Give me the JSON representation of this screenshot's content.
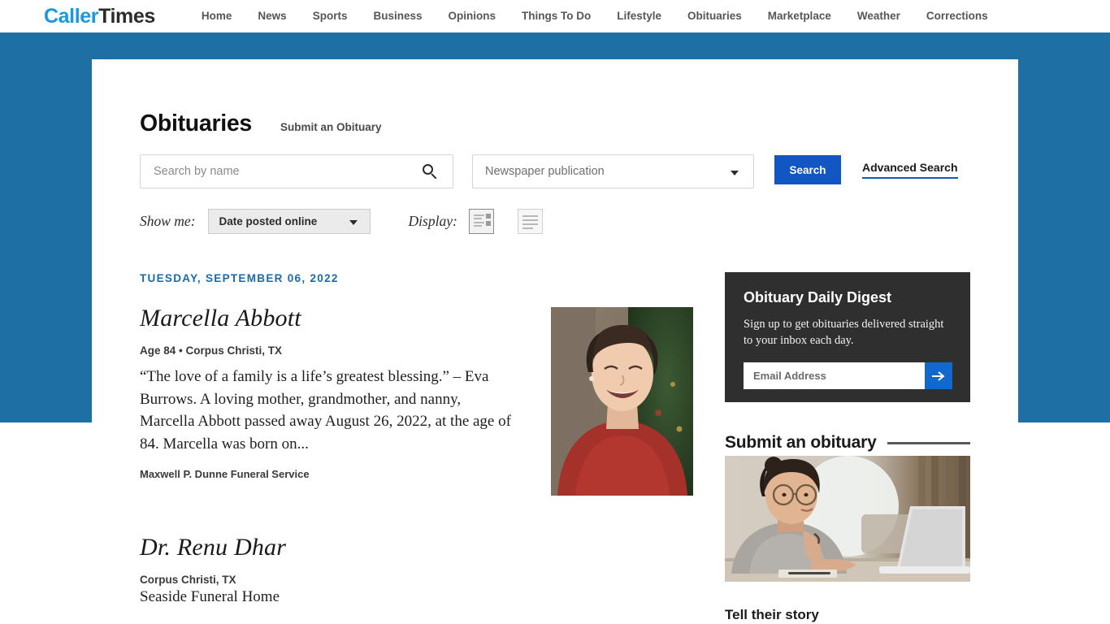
{
  "site": {
    "brand_first": "Caller",
    "brand_second": "Times",
    "nav": [
      "Home",
      "News",
      "Sports",
      "Business",
      "Opinions",
      "Things To Do",
      "Lifestyle",
      "Obituaries",
      "Marketplace",
      "Weather",
      "Corrections"
    ]
  },
  "colors": {
    "brand_blue": "#1999dd",
    "band_blue": "#1d6fa4",
    "button_blue": "#1256c4",
    "date_blue": "#1a6ba8",
    "digest_bg": "#2f2f2f",
    "arrow_blue": "#1268cd"
  },
  "header": {
    "title": "Obituaries",
    "submit_link": "Submit an Obituary"
  },
  "search": {
    "name_placeholder": "Search by name",
    "name_value": "",
    "publication_value": "Newspaper publication",
    "search_button": "Search",
    "advanced_link": "Advanced Search"
  },
  "filters": {
    "show_me_label": "Show me:",
    "sort_value": "Date posted online",
    "display_label": "Display:",
    "display_options": [
      "grid-with-thumbnails-view",
      "compact-list-view"
    ]
  },
  "listing": {
    "date_heading": "TUESDAY, SEPTEMBER 06, 2022",
    "entries": [
      {
        "name": "Marcella Abbott",
        "meta": "Age 84 • Corpus Christi, TX",
        "excerpt": "“The love of a family is a life’s greatest blessing.” – Eva Burrows. A loving mother, grandmother, and nanny, Marcella Abbott passed away August 26, 2022, at the age of 84. Marcella was born on...",
        "funeral_home": "Maxwell P. Dunne Funeral Service",
        "has_photo": true
      },
      {
        "name": "Dr. Renu Dhar",
        "meta": "Corpus Christi, TX",
        "funeral_home": "Seaside Funeral Home",
        "has_photo": false
      }
    ]
  },
  "digest": {
    "title": "Obituary Daily Digest",
    "copy": "Sign up to get obituaries delivered straight to your inbox each day.",
    "email_placeholder": "Email Address",
    "email_value": "",
    "submit_icon": "arrow-right-icon"
  },
  "promo": {
    "heading": "Submit an obituary",
    "caption": "Tell their story"
  }
}
